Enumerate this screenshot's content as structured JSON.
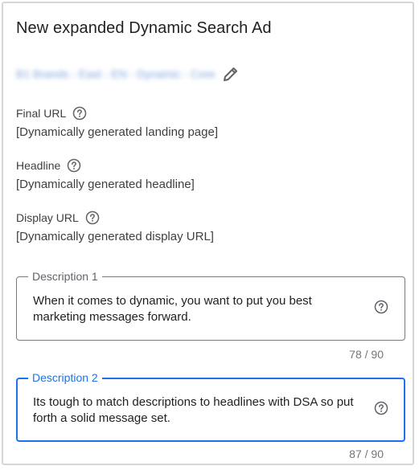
{
  "dialog": {
    "title": "New expanded Dynamic Search Ad",
    "campaign_name": "B1 Brands - East - EN - Dynamic - Core"
  },
  "fields": {
    "final_url": {
      "label": "Final URL",
      "value": "[Dynamically generated landing page]"
    },
    "headline": {
      "label": "Headline",
      "value": "[Dynamically generated headline]"
    },
    "display_url": {
      "label": "Display URL",
      "value": "[Dynamically generated display URL]"
    }
  },
  "descriptions": [
    {
      "label": "Description 1",
      "value": "When it comes to dynamic, you want to put you best marketing messages forward.",
      "counter": "78 / 90",
      "focused": false
    },
    {
      "label": "Description 2",
      "value": "Its tough to match descriptions to headlines with DSA so put forth a solid message set.",
      "counter": "87 / 90",
      "focused": true
    }
  ],
  "colors": {
    "accent": "#1a73e8",
    "border": "#7a7a7a",
    "text": "#202124",
    "muted": "#5f6368"
  },
  "icons": {
    "help": "help-circle-icon",
    "edit": "pencil-icon"
  }
}
